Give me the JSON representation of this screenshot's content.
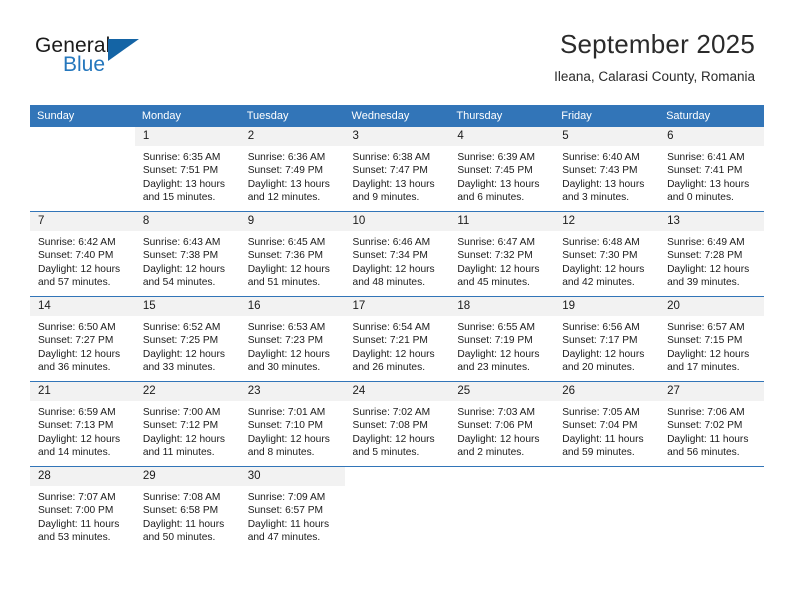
{
  "brand": {
    "name_part1": "General",
    "name_part2": "Blue",
    "triangle_icon": "triangle-icon",
    "accent_color": "#2577bd",
    "logo_triangle_color": "#1464a5"
  },
  "header": {
    "month_title": "September 2025",
    "location": "Ileana, Calarasi County, Romania"
  },
  "calendar": {
    "header_color": "#3275b8",
    "daynum_band_color": "#f2f2f2",
    "weekday_headers": [
      "Sunday",
      "Monday",
      "Tuesday",
      "Wednesday",
      "Thursday",
      "Friday",
      "Saturday"
    ],
    "weeks": [
      [
        {
          "day": "",
          "sunrise": "",
          "sunset": "",
          "daylight1": "",
          "daylight2": ""
        },
        {
          "day": "1",
          "sunrise": "Sunrise: 6:35 AM",
          "sunset": "Sunset: 7:51 PM",
          "daylight1": "Daylight: 13 hours",
          "daylight2": "and 15 minutes."
        },
        {
          "day": "2",
          "sunrise": "Sunrise: 6:36 AM",
          "sunset": "Sunset: 7:49 PM",
          "daylight1": "Daylight: 13 hours",
          "daylight2": "and 12 minutes."
        },
        {
          "day": "3",
          "sunrise": "Sunrise: 6:38 AM",
          "sunset": "Sunset: 7:47 PM",
          "daylight1": "Daylight: 13 hours",
          "daylight2": "and 9 minutes."
        },
        {
          "day": "4",
          "sunrise": "Sunrise: 6:39 AM",
          "sunset": "Sunset: 7:45 PM",
          "daylight1": "Daylight: 13 hours",
          "daylight2": "and 6 minutes."
        },
        {
          "day": "5",
          "sunrise": "Sunrise: 6:40 AM",
          "sunset": "Sunset: 7:43 PM",
          "daylight1": "Daylight: 13 hours",
          "daylight2": "and 3 minutes."
        },
        {
          "day": "6",
          "sunrise": "Sunrise: 6:41 AM",
          "sunset": "Sunset: 7:41 PM",
          "daylight1": "Daylight: 13 hours",
          "daylight2": "and 0 minutes."
        }
      ],
      [
        {
          "day": "7",
          "sunrise": "Sunrise: 6:42 AM",
          "sunset": "Sunset: 7:40 PM",
          "daylight1": "Daylight: 12 hours",
          "daylight2": "and 57 minutes."
        },
        {
          "day": "8",
          "sunrise": "Sunrise: 6:43 AM",
          "sunset": "Sunset: 7:38 PM",
          "daylight1": "Daylight: 12 hours",
          "daylight2": "and 54 minutes."
        },
        {
          "day": "9",
          "sunrise": "Sunrise: 6:45 AM",
          "sunset": "Sunset: 7:36 PM",
          "daylight1": "Daylight: 12 hours",
          "daylight2": "and 51 minutes."
        },
        {
          "day": "10",
          "sunrise": "Sunrise: 6:46 AM",
          "sunset": "Sunset: 7:34 PM",
          "daylight1": "Daylight: 12 hours",
          "daylight2": "and 48 minutes."
        },
        {
          "day": "11",
          "sunrise": "Sunrise: 6:47 AM",
          "sunset": "Sunset: 7:32 PM",
          "daylight1": "Daylight: 12 hours",
          "daylight2": "and 45 minutes."
        },
        {
          "day": "12",
          "sunrise": "Sunrise: 6:48 AM",
          "sunset": "Sunset: 7:30 PM",
          "daylight1": "Daylight: 12 hours",
          "daylight2": "and 42 minutes."
        },
        {
          "day": "13",
          "sunrise": "Sunrise: 6:49 AM",
          "sunset": "Sunset: 7:28 PM",
          "daylight1": "Daylight: 12 hours",
          "daylight2": "and 39 minutes."
        }
      ],
      [
        {
          "day": "14",
          "sunrise": "Sunrise: 6:50 AM",
          "sunset": "Sunset: 7:27 PM",
          "daylight1": "Daylight: 12 hours",
          "daylight2": "and 36 minutes."
        },
        {
          "day": "15",
          "sunrise": "Sunrise: 6:52 AM",
          "sunset": "Sunset: 7:25 PM",
          "daylight1": "Daylight: 12 hours",
          "daylight2": "and 33 minutes."
        },
        {
          "day": "16",
          "sunrise": "Sunrise: 6:53 AM",
          "sunset": "Sunset: 7:23 PM",
          "daylight1": "Daylight: 12 hours",
          "daylight2": "and 30 minutes."
        },
        {
          "day": "17",
          "sunrise": "Sunrise: 6:54 AM",
          "sunset": "Sunset: 7:21 PM",
          "daylight1": "Daylight: 12 hours",
          "daylight2": "and 26 minutes."
        },
        {
          "day": "18",
          "sunrise": "Sunrise: 6:55 AM",
          "sunset": "Sunset: 7:19 PM",
          "daylight1": "Daylight: 12 hours",
          "daylight2": "and 23 minutes."
        },
        {
          "day": "19",
          "sunrise": "Sunrise: 6:56 AM",
          "sunset": "Sunset: 7:17 PM",
          "daylight1": "Daylight: 12 hours",
          "daylight2": "and 20 minutes."
        },
        {
          "day": "20",
          "sunrise": "Sunrise: 6:57 AM",
          "sunset": "Sunset: 7:15 PM",
          "daylight1": "Daylight: 12 hours",
          "daylight2": "and 17 minutes."
        }
      ],
      [
        {
          "day": "21",
          "sunrise": "Sunrise: 6:59 AM",
          "sunset": "Sunset: 7:13 PM",
          "daylight1": "Daylight: 12 hours",
          "daylight2": "and 14 minutes."
        },
        {
          "day": "22",
          "sunrise": "Sunrise: 7:00 AM",
          "sunset": "Sunset: 7:12 PM",
          "daylight1": "Daylight: 12 hours",
          "daylight2": "and 11 minutes."
        },
        {
          "day": "23",
          "sunrise": "Sunrise: 7:01 AM",
          "sunset": "Sunset: 7:10 PM",
          "daylight1": "Daylight: 12 hours",
          "daylight2": "and 8 minutes."
        },
        {
          "day": "24",
          "sunrise": "Sunrise: 7:02 AM",
          "sunset": "Sunset: 7:08 PM",
          "daylight1": "Daylight: 12 hours",
          "daylight2": "and 5 minutes."
        },
        {
          "day": "25",
          "sunrise": "Sunrise: 7:03 AM",
          "sunset": "Sunset: 7:06 PM",
          "daylight1": "Daylight: 12 hours",
          "daylight2": "and 2 minutes."
        },
        {
          "day": "26",
          "sunrise": "Sunrise: 7:05 AM",
          "sunset": "Sunset: 7:04 PM",
          "daylight1": "Daylight: 11 hours",
          "daylight2": "and 59 minutes."
        },
        {
          "day": "27",
          "sunrise": "Sunrise: 7:06 AM",
          "sunset": "Sunset: 7:02 PM",
          "daylight1": "Daylight: 11 hours",
          "daylight2": "and 56 minutes."
        }
      ],
      [
        {
          "day": "28",
          "sunrise": "Sunrise: 7:07 AM",
          "sunset": "Sunset: 7:00 PM",
          "daylight1": "Daylight: 11 hours",
          "daylight2": "and 53 minutes."
        },
        {
          "day": "29",
          "sunrise": "Sunrise: 7:08 AM",
          "sunset": "Sunset: 6:58 PM",
          "daylight1": "Daylight: 11 hours",
          "daylight2": "and 50 minutes."
        },
        {
          "day": "30",
          "sunrise": "Sunrise: 7:09 AM",
          "sunset": "Sunset: 6:57 PM",
          "daylight1": "Daylight: 11 hours",
          "daylight2": "and 47 minutes."
        },
        {
          "day": "",
          "sunrise": "",
          "sunset": "",
          "daylight1": "",
          "daylight2": ""
        },
        {
          "day": "",
          "sunrise": "",
          "sunset": "",
          "daylight1": "",
          "daylight2": ""
        },
        {
          "day": "",
          "sunrise": "",
          "sunset": "",
          "daylight1": "",
          "daylight2": ""
        },
        {
          "day": "",
          "sunrise": "",
          "sunset": "",
          "daylight1": "",
          "daylight2": ""
        }
      ]
    ]
  }
}
